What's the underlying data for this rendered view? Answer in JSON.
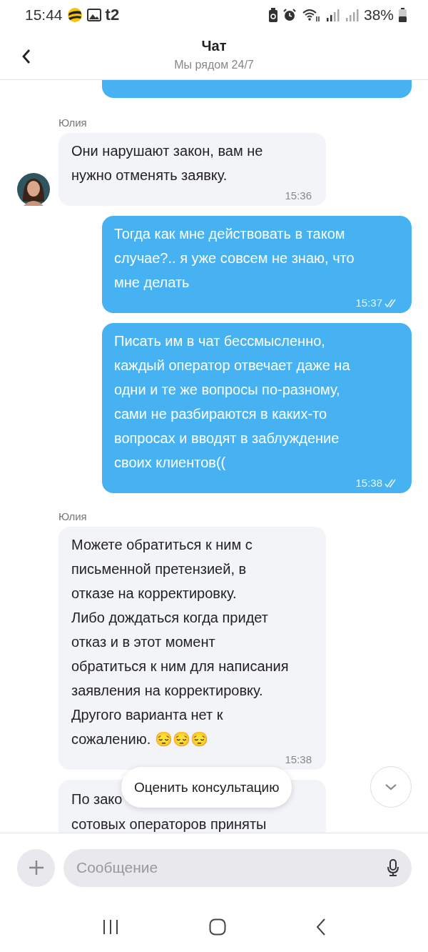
{
  "status_bar": {
    "time": "15:44",
    "carrier": "t2",
    "battery": "38%"
  },
  "header": {
    "title": "Чат",
    "subtitle": "Мы рядом 24/7"
  },
  "messages": [
    {
      "kind": "outgoing-cut"
    },
    {
      "kind": "incoming",
      "sender": "Юлия",
      "avatar": true,
      "text": "Они нарушают закон, вам не\nнужно отменять заявку.",
      "time": "15:36"
    },
    {
      "kind": "outgoing",
      "text": "Тогда как мне действовать в таком\nслучае?.. я уже совсем не знаю, что\nмне делать",
      "time": "15:37",
      "read": true
    },
    {
      "kind": "outgoing",
      "text": "Писать им в чат бессмысленно,\nкаждый оператор отвечает даже на\nодни и те же вопросы по-разному,\nсами не разбираются в каких-то\nвопросах и вводят в заблуждение\nсвоих клиентов((",
      "time": "15:38",
      "read": true
    },
    {
      "kind": "incoming",
      "sender": "Юлия",
      "avatar": false,
      "text": "Можете обратиться к ним с\nписьменной претензией, в\nотказе на корректировку.\nЛибо дождаться когда придет\nотказ и в этот момент\nобратиться к ним для написания\nзаявления на корректировку.\nДругого варианта нет к\nсожалению. 😔😔😔",
      "time": "15:38"
    },
    {
      "kind": "incoming-cut",
      "lines": [
        "По зако",
        "сотовых операторов приняты"
      ]
    }
  ],
  "rate_button": "Оценить консультацию",
  "composer": {
    "placeholder": "Сообщение"
  }
}
